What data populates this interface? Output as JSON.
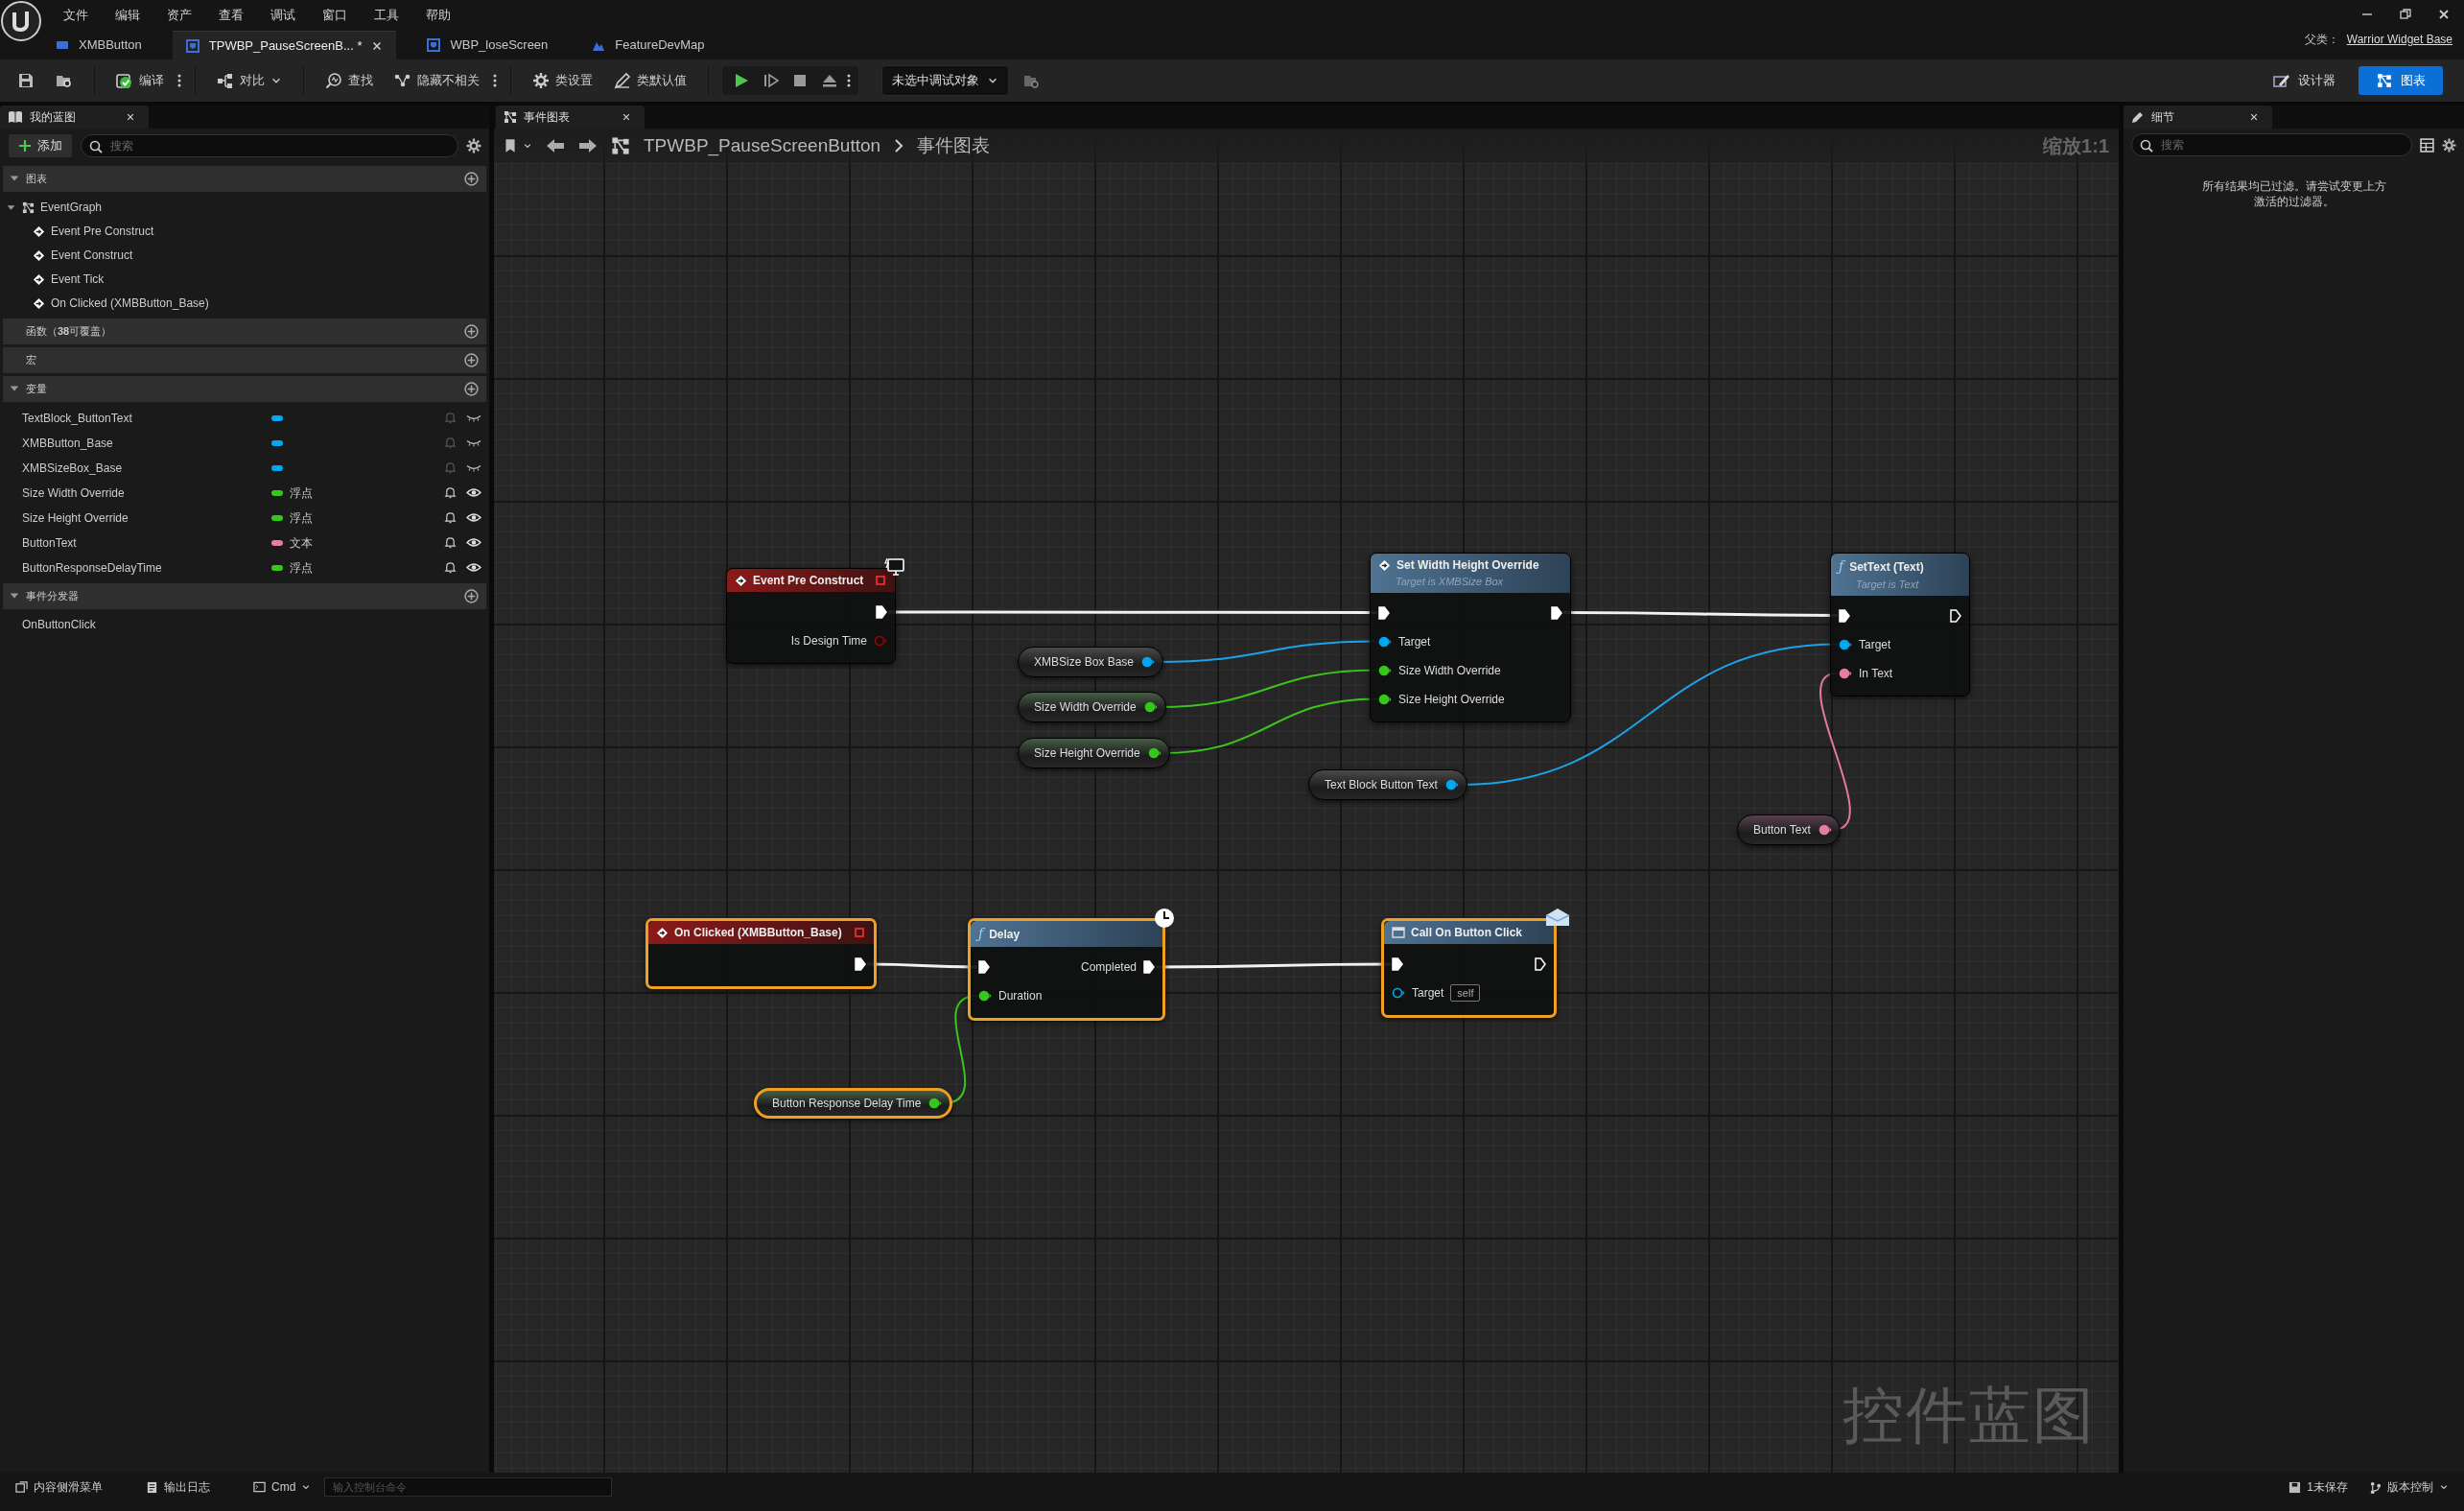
{
  "menu": [
    "文件",
    "编辑",
    "资产",
    "查看",
    "调试",
    "窗口",
    "工具",
    "帮助"
  ],
  "tabs": [
    {
      "label": "XMBButton",
      "kind": "widget",
      "selected": false
    },
    {
      "label": "TPWBP_PauseScreenB... *",
      "kind": "blueprint",
      "selected": true
    },
    {
      "label": "WBP_loseScreen",
      "kind": "blueprint",
      "selected": false
    },
    {
      "label": "FeatureDevMap",
      "kind": "level",
      "selected": false
    }
  ],
  "parent_class": {
    "label": "父类：",
    "value": "Warrior Widget Base"
  },
  "toolbar": {
    "items": [
      {
        "kind": "compile",
        "label": "编译"
      },
      {
        "kind": "diff",
        "label": "对比"
      },
      {
        "kind": "find",
        "label": "查找"
      },
      {
        "kind": "hide_unrelated",
        "label": "隐藏不相关"
      },
      {
        "kind": "class_settings",
        "label": "类设置"
      },
      {
        "kind": "class_defaults",
        "label": "类默认值"
      }
    ],
    "debug_target": "未选中调试对象"
  },
  "mode_buttons": [
    {
      "label": "设计器",
      "kind": "designer",
      "selected": false
    },
    {
      "label": "图表",
      "kind": "graph",
      "selected": true
    }
  ],
  "my_blueprint": {
    "title": "我的蓝图",
    "add_label": "添加",
    "search_placeholder": "搜索",
    "sections": [
      {
        "kind": "graphs",
        "label": "图表",
        "expanded": true,
        "items": [
          {
            "label": "EventGraph",
            "expanded": true,
            "children": [
              {
                "label": "Event Pre Construct"
              },
              {
                "label": "Event Construct"
              },
              {
                "label": "Event Tick"
              },
              {
                "label": "On Clicked (XMBButton_Base)"
              }
            ]
          }
        ]
      },
      {
        "kind": "functions",
        "label": "函数（**38**可覆盖）",
        "expanded": false
      },
      {
        "kind": "macros",
        "label": "宏",
        "expanded": false
      },
      {
        "kind": "variables",
        "label": "变量",
        "expanded": true,
        "variables": [
          {
            "name": "TextBlock_ButtonText",
            "color": "#00a8f3",
            "exposed": false
          },
          {
            "name": "XMBButton_Base",
            "color": "#00a8f3",
            "exposed": false
          },
          {
            "name": "XMBSizeBox_Base",
            "color": "#00a8f3",
            "exposed": false
          },
          {
            "name": "Size Width Override",
            "color": "#35c81a",
            "type": "浮点",
            "exposed": true
          },
          {
            "name": "Size Height Override",
            "color": "#35c81a",
            "type": "浮点",
            "exposed": true
          },
          {
            "name": "ButtonText",
            "color": "#e67ba5",
            "type": "文本",
            "exposed": true
          },
          {
            "name": "ButtonResponseDelayTime",
            "color": "#35c81a",
            "type": "浮点",
            "exposed": true
          }
        ]
      },
      {
        "kind": "dispatchers",
        "label": "事件分发器",
        "expanded": true,
        "items": [
          {
            "label": "OnButtonClick"
          }
        ]
      }
    ]
  },
  "graph": {
    "tab": "事件图表",
    "breadcrumb": [
      "TPWBP_PauseScreenButton",
      "事件图表"
    ],
    "zoom": "缩放1:1",
    "watermark": "控件蓝图",
    "nodes": [
      {
        "kind": "editor_event",
        "title": "Event Pre Construct",
        "selected": false,
        "rows": [
          {
            "right": {
              "kind": "exec",
              "connected": true
            }
          },
          {
            "right": {
              "kind": "bool",
              "label": "Is Design Time",
              "connected": false
            }
          }
        ]
      },
      {
        "kind": "function",
        "title": "Set Width Height Override",
        "subtitle": "Target is XMBSize Box",
        "selected": false,
        "rows": [
          {
            "left": {
              "kind": "exec",
              "connected": true
            },
            "right": {
              "kind": "exec",
              "connected": true
            }
          },
          {
            "left": {
              "kind": "object",
              "label": "Target",
              "connected": true
            }
          },
          {
            "left": {
              "kind": "float",
              "label": "Size Width Override",
              "connected": true
            }
          },
          {
            "left": {
              "kind": "float",
              "label": "Size Height Override",
              "connected": true
            }
          }
        ]
      },
      {
        "kind": "function",
        "glyph": "ƒ",
        "title": "SetText (Text)",
        "subtitle": "Target is Text",
        "selected": false,
        "rows": [
          {
            "left": {
              "kind": "exec",
              "connected": true
            },
            "right": {
              "kind": "exec",
              "connected": false
            }
          },
          {
            "left": {
              "kind": "object",
              "label": "Target",
              "connected": true
            }
          },
          {
            "left": {
              "kind": "text",
              "label": "In Text",
              "connected": true
            }
          }
        ]
      },
      {
        "kind": "variable",
        "title": "XMBSize Box Base",
        "selected": false,
        "rows": [
          {
            "right": {
              "kind": "object",
              "connected": true
            }
          }
        ]
      },
      {
        "kind": "variable",
        "title": "Size Width Override",
        "selected": false,
        "rows": [
          {
            "right": {
              "kind": "float",
              "connected": true
            }
          }
        ]
      },
      {
        "kind": "variable",
        "title": "Size Height Override",
        "selected": false,
        "rows": [
          {
            "right": {
              "kind": "float",
              "connected": true
            }
          }
        ]
      },
      {
        "kind": "variable",
        "title": "Text Block Button Text",
        "selected": false,
        "rows": [
          {
            "right": {
              "kind": "object",
              "connected": true
            }
          }
        ]
      },
      {
        "kind": "variable",
        "title": "Button Text",
        "selected": false,
        "rows": [
          {
            "right": {
              "kind": "text",
              "connected": true
            }
          }
        ]
      },
      {
        "kind": "event",
        "title": "On Clicked (XMBButton_Base)",
        "selected": true,
        "rows": [
          {
            "right": {
              "kind": "exec",
              "connected": true
            }
          }
        ]
      },
      {
        "kind": "latent_function",
        "glyph": "ƒ",
        "title": "Delay",
        "selected": true,
        "rows": [
          {
            "left": {
              "kind": "exec",
              "connected": true
            },
            "right": {
              "kind": "exec",
              "label": "Completed",
              "connected": true
            }
          },
          {
            "left": {
              "kind": "float",
              "label": "Duration",
              "connected": true
            }
          }
        ]
      },
      {
        "kind": "message_call",
        "title": "Call On Button Click",
        "selected": true,
        "rows": [
          {
            "left": {
              "kind": "exec",
              "connected": true
            },
            "right": {
              "kind": "exec",
              "connected": false
            }
          },
          {
            "left": {
              "kind": "object",
              "label": "Target",
              "value": "self",
              "connected": false
            }
          }
        ]
      },
      {
        "kind": "variable",
        "title": "Button Response Delay Time",
        "selected": true,
        "rows": [
          {
            "right": {
              "kind": "float",
              "connected": true
            }
          }
        ]
      }
    ]
  },
  "details": {
    "title": "细节",
    "search_placeholder": "搜索",
    "message": "所有结果均已过滤。请尝试变更上方激活的过滤器。"
  },
  "status_bar": {
    "left": [
      {
        "kind": "drawer",
        "label": "内容侧滑菜单"
      },
      {
        "kind": "log",
        "label": "输出日志"
      }
    ],
    "cmd": {
      "label": "Cmd",
      "placeholder": "输入控制台命令"
    },
    "right": [
      {
        "kind": "save",
        "label": "1未保存"
      },
      {
        "kind": "vcs",
        "label": "版本控制"
      }
    ]
  }
}
